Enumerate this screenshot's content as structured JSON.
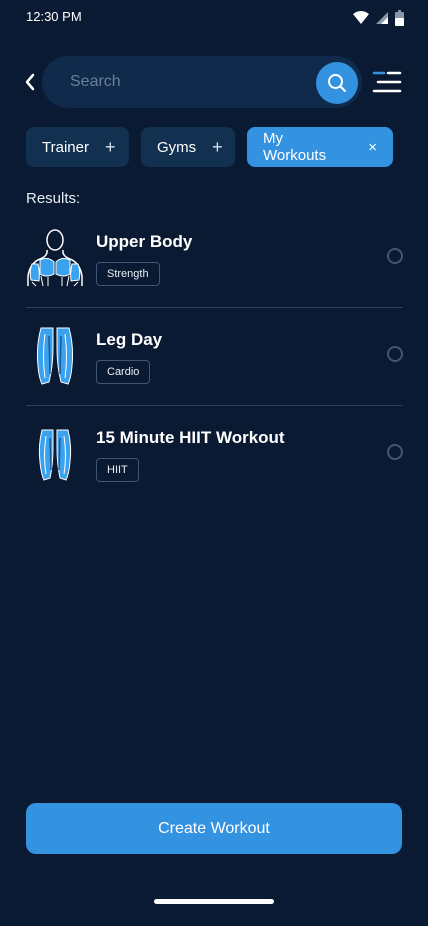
{
  "status_bar": {
    "time": "12:30 PM",
    "icons": [
      "wifi-icon",
      "signal-icon",
      "battery-icon"
    ]
  },
  "header": {
    "search_placeholder": "Search",
    "back_icon": "chevron-left-icon",
    "search_icon": "search-icon",
    "menu_icon": "menu-icon"
  },
  "filters": [
    {
      "label": "Trainer",
      "icon": "+",
      "active": false
    },
    {
      "label": "Gyms",
      "icon": "+",
      "active": false
    },
    {
      "label": "My Workouts",
      "icon": "×",
      "active": true
    }
  ],
  "results_label": "Results:",
  "workouts": [
    {
      "title": "Upper Body",
      "tag": "Strength",
      "thumb": "upper-body-muscle-icon",
      "selected": false
    },
    {
      "title": "Leg Day",
      "tag": "Cardio",
      "thumb": "legs-muscle-icon",
      "selected": false
    },
    {
      "title": "15 Minute HIIT Workout",
      "tag": "HIIT",
      "thumb": "legs-muscle-icon",
      "selected": false
    }
  ],
  "create_button_label": "Create Workout",
  "colors": {
    "background": "#0b1a33",
    "accent": "#3493e0",
    "chip": "#12304f",
    "search_field": "#0f2a4a"
  }
}
